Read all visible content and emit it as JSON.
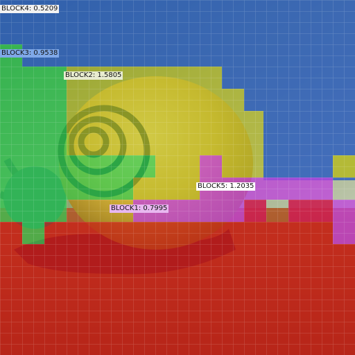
{
  "image": {
    "subject": "snail with yellow-green spiral shell on orange-brown surface",
    "icon": "segmentation-overlay"
  },
  "legend": {
    "colors": {
      "block1": "#d01515",
      "block2": "#bdbd2a",
      "block3": "#2ecc55",
      "block4": "#2f5fc0",
      "block5": "#c040e0"
    }
  },
  "blocks": [
    {
      "id": "block4",
      "name": "BLOCK4",
      "value": "0.5209",
      "label_bg": "#f2f2f2"
    },
    {
      "id": "block3",
      "name": "BLOCK3",
      "value": "0.9538",
      "label_bg": "#7fa8e8"
    },
    {
      "id": "block2",
      "name": "BLOCK2",
      "value": "1.5805",
      "label_bg": "#e8ecd0"
    },
    {
      "id": "block5",
      "name": "BLOCK5",
      "value": "1.2035",
      "label_bg": "#ffffff"
    },
    {
      "id": "block1",
      "name": "BLOCK1",
      "value": "0.7995",
      "label_bg": "#e8b8f0"
    }
  ]
}
